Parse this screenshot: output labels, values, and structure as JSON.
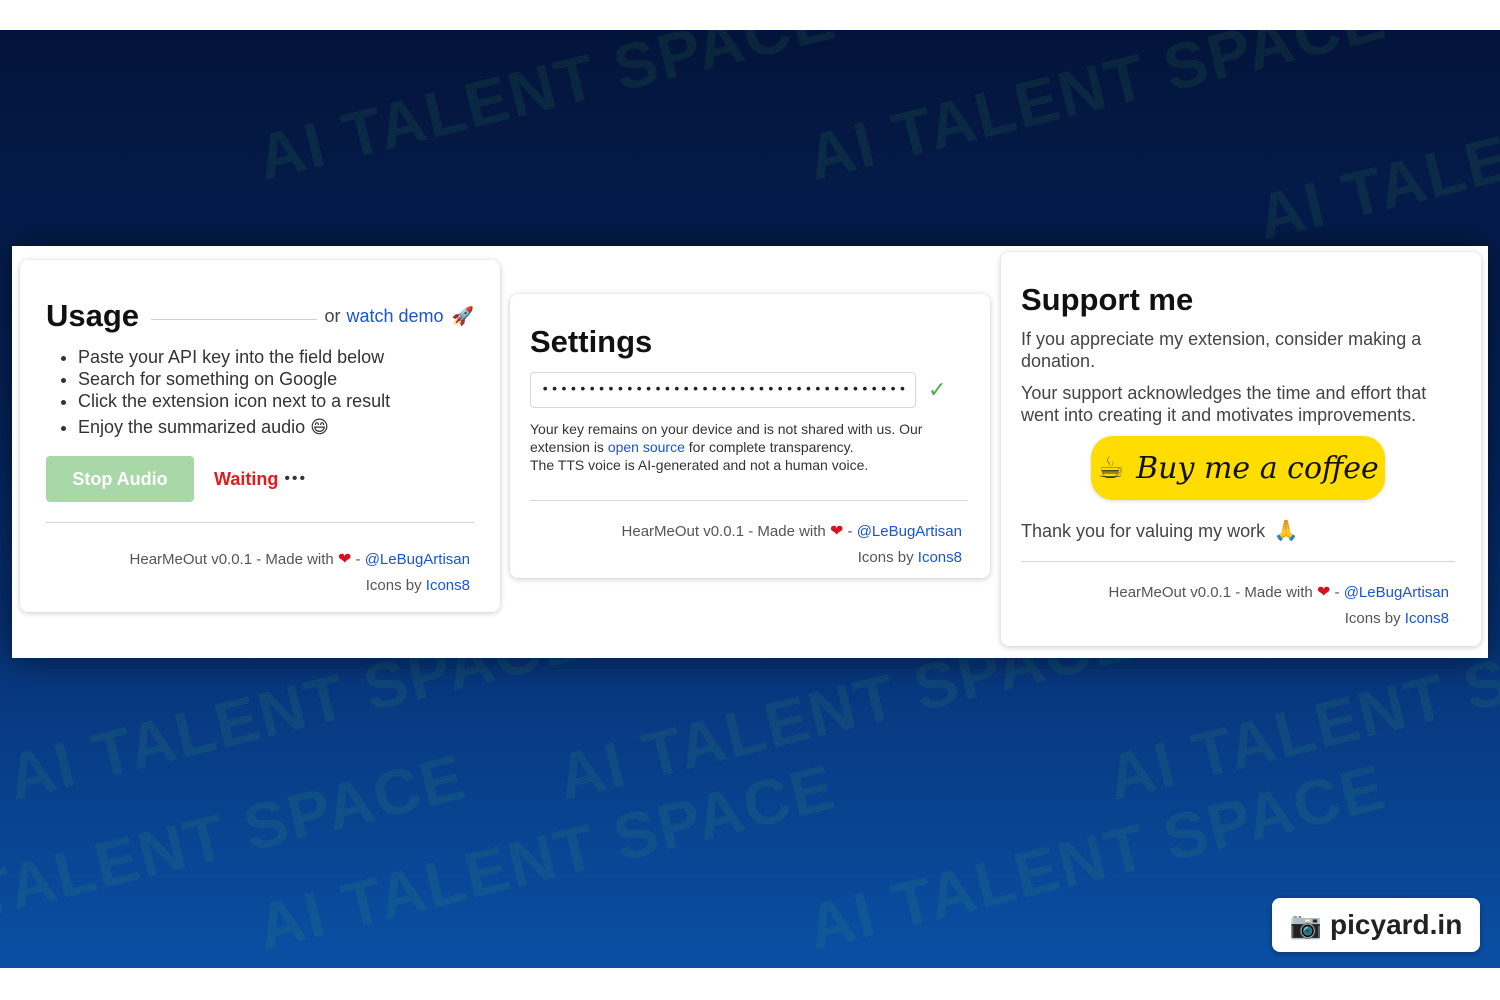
{
  "watermark": {
    "text": "AI TALENT SPACE"
  },
  "usage": {
    "title": "Usage",
    "demo_prefix": "or",
    "demo_link": "watch demo",
    "demo_icon": "rocket-icon",
    "steps": [
      "Paste your API key into the field below",
      "Search for something on Google",
      "Click the extension icon next to a result",
      "Enjoy the summarized audio"
    ],
    "step4_icon": "grinning-face-icon",
    "stop_button": "Stop Audio",
    "status": "Waiting",
    "status_dots": "•••"
  },
  "settings": {
    "title": "Settings",
    "api_key_value": "••••••••••••••••••••••••••••••••••••••••••••••••••",
    "check_icon": "check-icon",
    "note_part1": "Your key remains on your device and is not shared with us. Our extension is",
    "note_link": "open source",
    "note_part2": "for complete transparency.",
    "note_line2": "The TTS voice is AI-generated and not a human voice."
  },
  "support": {
    "title": "Support me",
    "para1": "If you appreciate my extension, consider making a donation.",
    "para2": "Your support acknowledges the time and effort that went into creating it and motivates improvements.",
    "coffee_button": "Buy me a coffee",
    "thanks": "Thank you for valuing my work",
    "thanks_icon": "folded-hands-icon"
  },
  "footer": {
    "made_with": "HearMeOut v0.0.1 - Made with",
    "separator": "-",
    "author": "@LeBugArtisan",
    "icons_by": "Icons by",
    "icons_link": "Icons8"
  },
  "badge": {
    "text": "picyard.in"
  },
  "colors": {
    "link": "#1a55cc",
    "stop_button_bg": "#a8d8a8",
    "waiting": "#e41b1b",
    "coffee_yellow": "#ffdd00",
    "heart": "#d3141e",
    "check": "#4caf50"
  }
}
